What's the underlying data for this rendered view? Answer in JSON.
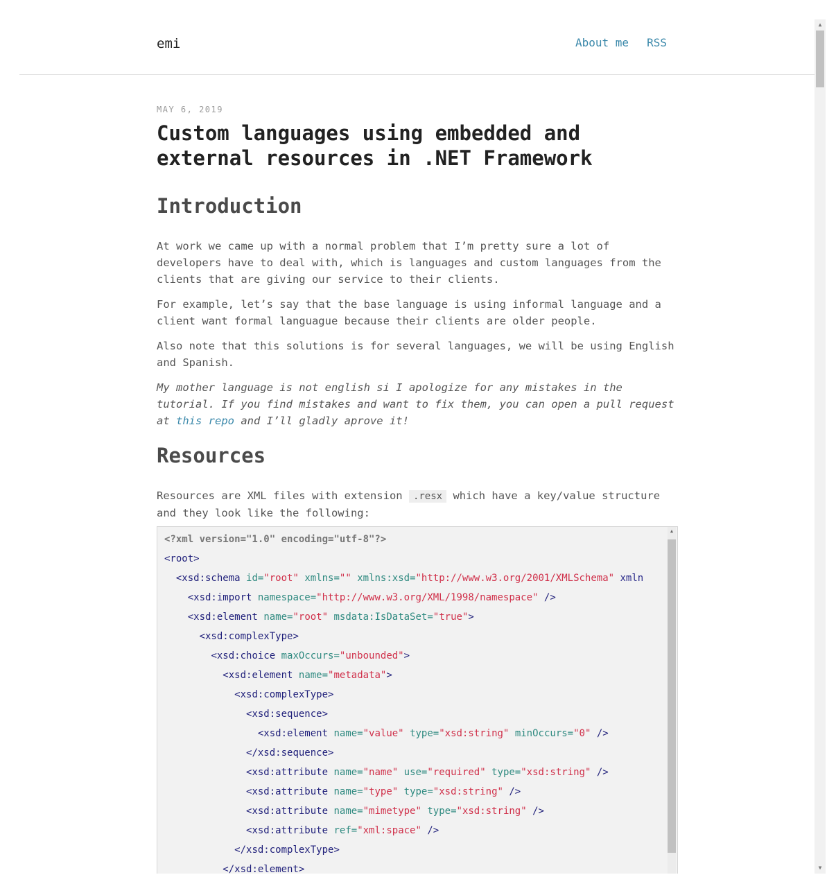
{
  "site": {
    "brand": "emi",
    "nav": [
      "About me",
      "RSS"
    ]
  },
  "post": {
    "date": "May 6, 2019",
    "title": "Custom languages using embedded and external resources in .NET Framework",
    "intro_heading": "Introduction",
    "p1": "At work we came up with a normal problem that I’m pretty sure a lot of developers have to deal with, which is languages and custom languages from the clients that are giving our service to their clients.",
    "p2": "For example, let’s say that the base language is using informal language and a client want formal languague because their clients are older people.",
    "p3": "Also note that this solutions is for several languages, we will be using English and Spanish.",
    "p4_before": "My mother language is not english si I apologize for any mistakes in the tutorial. If you find mistakes and want to fix them, you can open a pull request at ",
    "p4_link": "this repo",
    "p4_after": " and I’ll gladly aprove it!",
    "resources_heading": "Resources",
    "p5_before": "Resources are XML files with extension ",
    "p5_code": ".resx",
    "p5_after": " which have a key/value structure and they look like the following:"
  },
  "code": {
    "lines": [
      "<?xml version=\"1.0\" encoding=\"utf-8\"?>",
      "<root>",
      "  <xsd:schema id=\"root\" xmlns=\"\" xmlns:xsd=\"http://www.w3.org/2001/XMLSchema\" xmln",
      "    <xsd:import namespace=\"http://www.w3.org/XML/1998/namespace\" />",
      "    <xsd:element name=\"root\" msdata:IsDataSet=\"true\">",
      "      <xsd:complexType>",
      "        <xsd:choice maxOccurs=\"unbounded\">",
      "          <xsd:element name=\"metadata\">",
      "            <xsd:complexType>",
      "              <xsd:sequence>",
      "                <xsd:element name=\"value\" type=\"xsd:string\" minOccurs=\"0\" />",
      "              </xsd:sequence>",
      "              <xsd:attribute name=\"name\" use=\"required\" type=\"xsd:string\" />",
      "              <xsd:attribute name=\"type\" type=\"xsd:string\" />",
      "              <xsd:attribute name=\"mimetype\" type=\"xsd:string\" />",
      "              <xsd:attribute ref=\"xml:space\" />",
      "            </xsd:complexType>",
      "          </xsd:element>"
    ]
  }
}
